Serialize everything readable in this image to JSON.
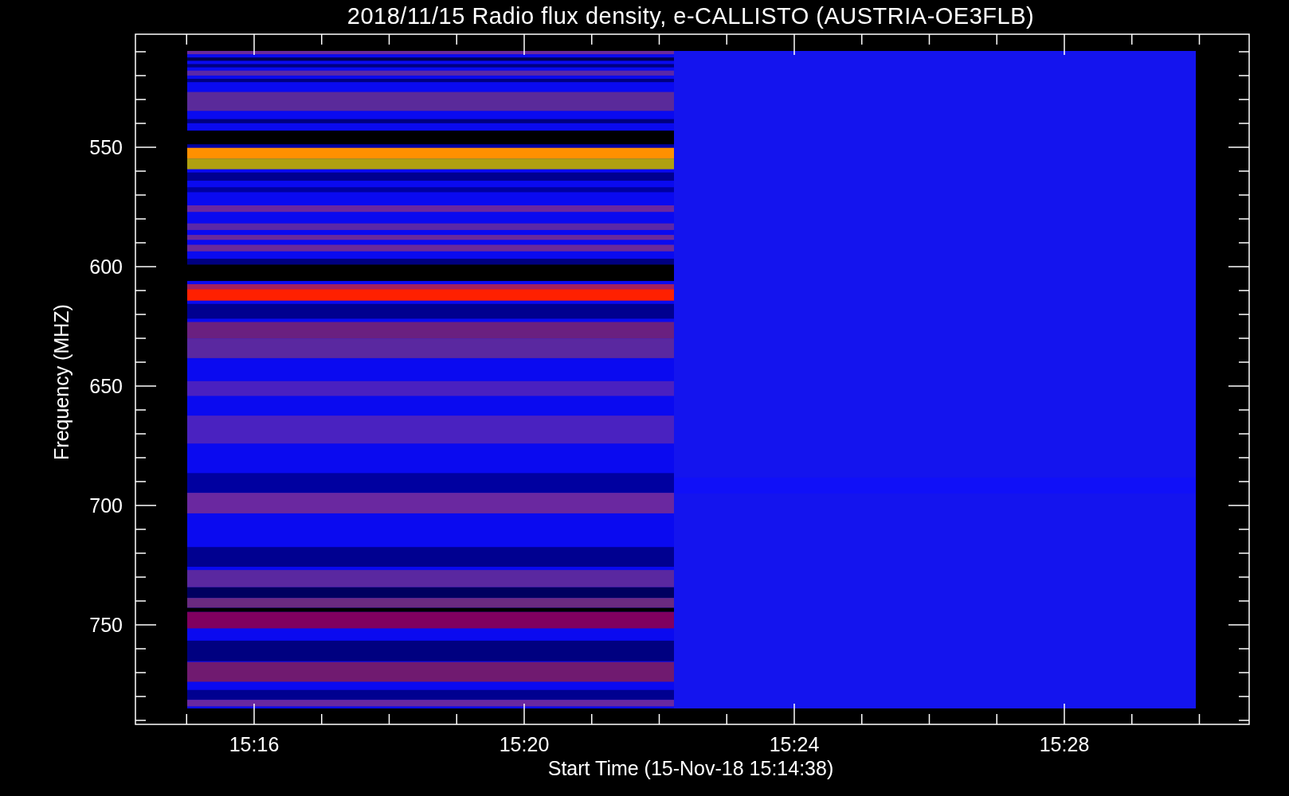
{
  "title": "2018/11/15  Radio flux density, e-CALLISTO (AUSTRIA-OE3FLB)",
  "y_axis": {
    "label": "Frequency (MHZ)",
    "ticks": [
      "550",
      "600",
      "650",
      "700",
      "750"
    ]
  },
  "x_axis": {
    "label": "Start Time (15-Nov-18 15:14:38)",
    "ticks": [
      "15:16",
      "15:20",
      "15:24",
      "15:28"
    ]
  }
}
